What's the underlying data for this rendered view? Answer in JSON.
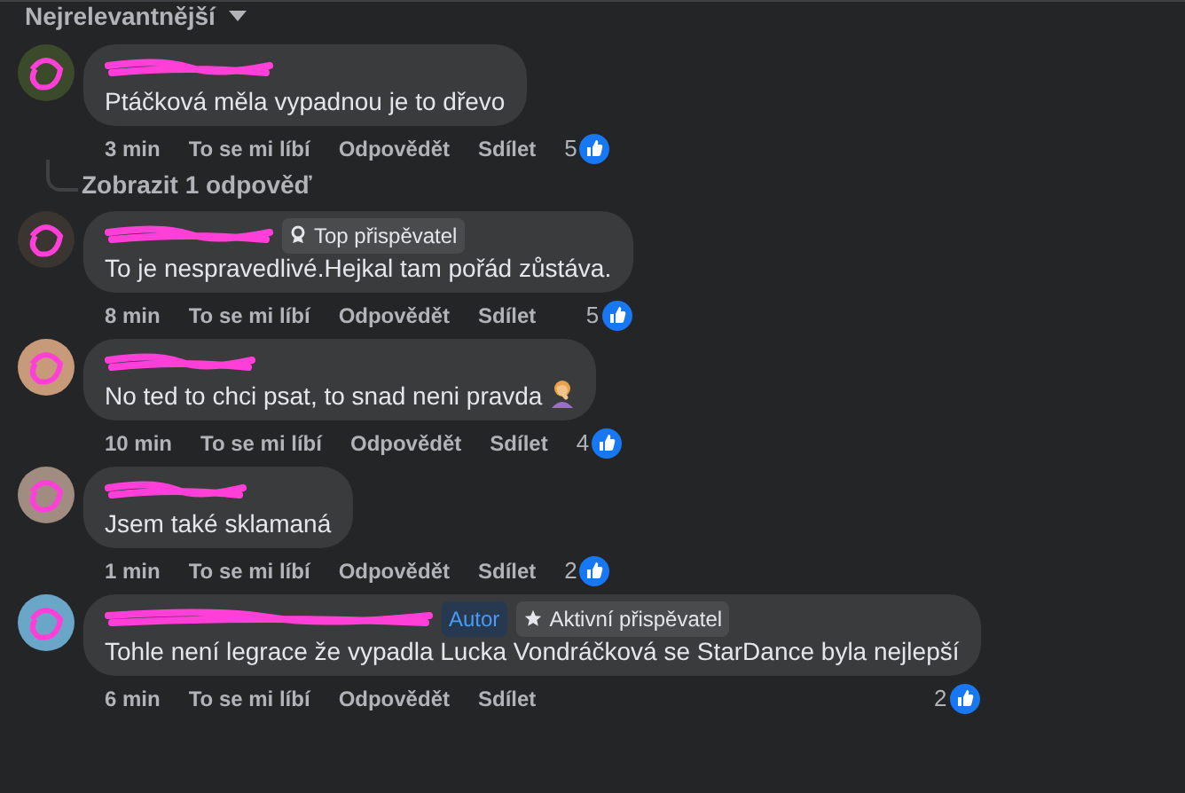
{
  "sort": {
    "label": "Nejrelevantnější"
  },
  "comments": [
    {
      "kind": "plain",
      "text": "Ptáčková měla vypadnou je to dřevo",
      "time": "3 min",
      "actions": [
        "To se mi líbí",
        "Odpovědět",
        "Sdílet"
      ],
      "likes": "5",
      "replies": "Zobrazit 1 odpověď"
    },
    {
      "kind": "plain",
      "badges": [
        {
          "kind": "top",
          "label": "Top přispěvatel"
        }
      ],
      "text": "To je nespravedlivé.Hejkal tam pořád zůstáva.",
      "time": "8 min",
      "actions": [
        "To se mi líbí",
        "Odpovědět",
        "Sdílet"
      ],
      "likes": "5"
    },
    {
      "kind": "emoji",
      "text": "No ted to chci psat, to snad neni pravda",
      "time": "10 min",
      "actions": [
        "To se mi líbí",
        "Odpovědět",
        "Sdílet"
      ],
      "likes": "4"
    },
    {
      "kind": "plain",
      "text": "Jsem také sklamaná",
      "time": "1 min",
      "actions": [
        "To se mi líbí",
        "Odpovědět",
        "Sdílet"
      ],
      "likes": "2"
    },
    {
      "kind": "plain",
      "badges": [
        {
          "kind": "author",
          "label": "Autor"
        },
        {
          "kind": "active",
          "label": "Aktivní přispěvatel"
        }
      ],
      "text": "Tohle není legrace že vypadla Lucka Vondráčková se StarDance byla nejlepší",
      "time": "6 min",
      "actions": [
        "To se mi líbí",
        "Odpovědět",
        "Sdílet"
      ],
      "likes": "2"
    }
  ]
}
